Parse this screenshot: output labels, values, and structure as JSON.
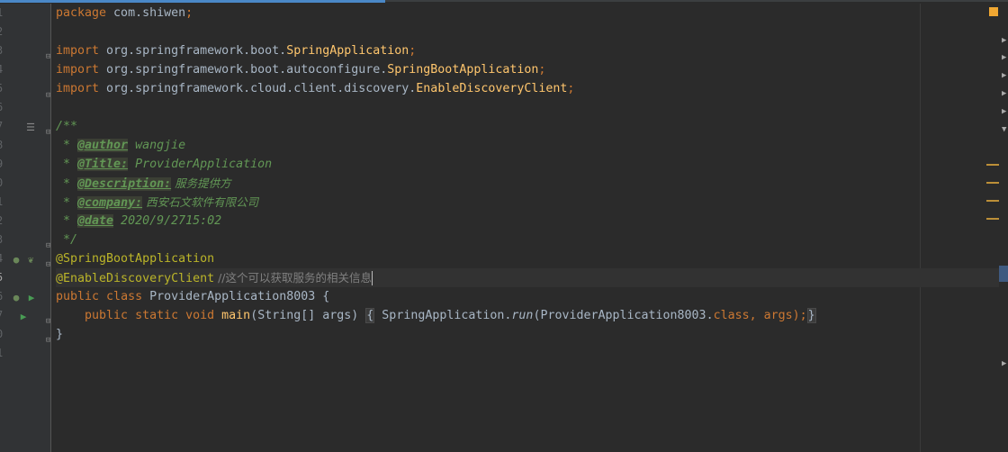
{
  "editor": {
    "line_numbers": [
      "1",
      "2",
      "3",
      "4",
      "5",
      "6",
      "7",
      "8",
      "9",
      "0",
      "1",
      "2",
      "3",
      "4",
      "5",
      "6",
      "7",
      "0",
      "1"
    ],
    "code": {
      "l1": {
        "kw": "package",
        "rest": " com.shiwen",
        "semi": ";"
      },
      "l3": {
        "kw": "import",
        "rest": " org.springframework.boot.",
        "cls": "SpringApplication",
        "semi": ";"
      },
      "l4": {
        "kw": "import",
        "rest": " org.springframework.boot.autoconfigure.",
        "cls": "SpringBootApplication",
        "semi": ";"
      },
      "l5": {
        "kw": "import",
        "rest": " org.springframework.cloud.client.discovery.",
        "cls": "EnableDiscoveryClient",
        "semi": ";"
      },
      "l7": {
        "text": "/**"
      },
      "l8": {
        "prefix": " * ",
        "tag": "@author",
        "value": " wangjie"
      },
      "l9": {
        "prefix": " * ",
        "tag": "@Title:",
        "value": " ProviderApplication"
      },
      "l10": {
        "prefix": " * ",
        "tag": "@Description:",
        "value": " 服务提供方"
      },
      "l11": {
        "prefix": " * ",
        "tag": "@company:",
        "value": " 西安石文软件有限公司"
      },
      "l12": {
        "prefix": " * ",
        "tag": "@date",
        "value": " 2020/9/2715:02"
      },
      "l13": {
        "text": " */"
      },
      "l14": {
        "ann": "@SpringBootApplication"
      },
      "l15": {
        "ann": "@EnableDiscoveryClient",
        "comment": " //这个可以获取服务的相关信息"
      },
      "l16": {
        "kw1": "public",
        "kw2": " class",
        "name": " ProviderApplication8003 {"
      },
      "l17": {
        "indent": "    ",
        "kws": "public static void",
        "method": "main",
        "params": "(String[] args) ",
        "brace_open": "{",
        "cls": " SpringApplication.",
        "run": "run",
        "args1": "(ProviderApplication8003.",
        "kwclass": "class",
        "args2": ", args);",
        "brace_close": "}"
      },
      "l18": {
        "text": "}"
      }
    }
  },
  "colors": {
    "background": "#2b2b2b",
    "gutter": "#313335",
    "keyword": "#cc7832",
    "annotation": "#bbb529",
    "doc_comment": "#629755",
    "comment": "#808080",
    "method": "#ffc66d",
    "text": "#a9b7c6"
  }
}
